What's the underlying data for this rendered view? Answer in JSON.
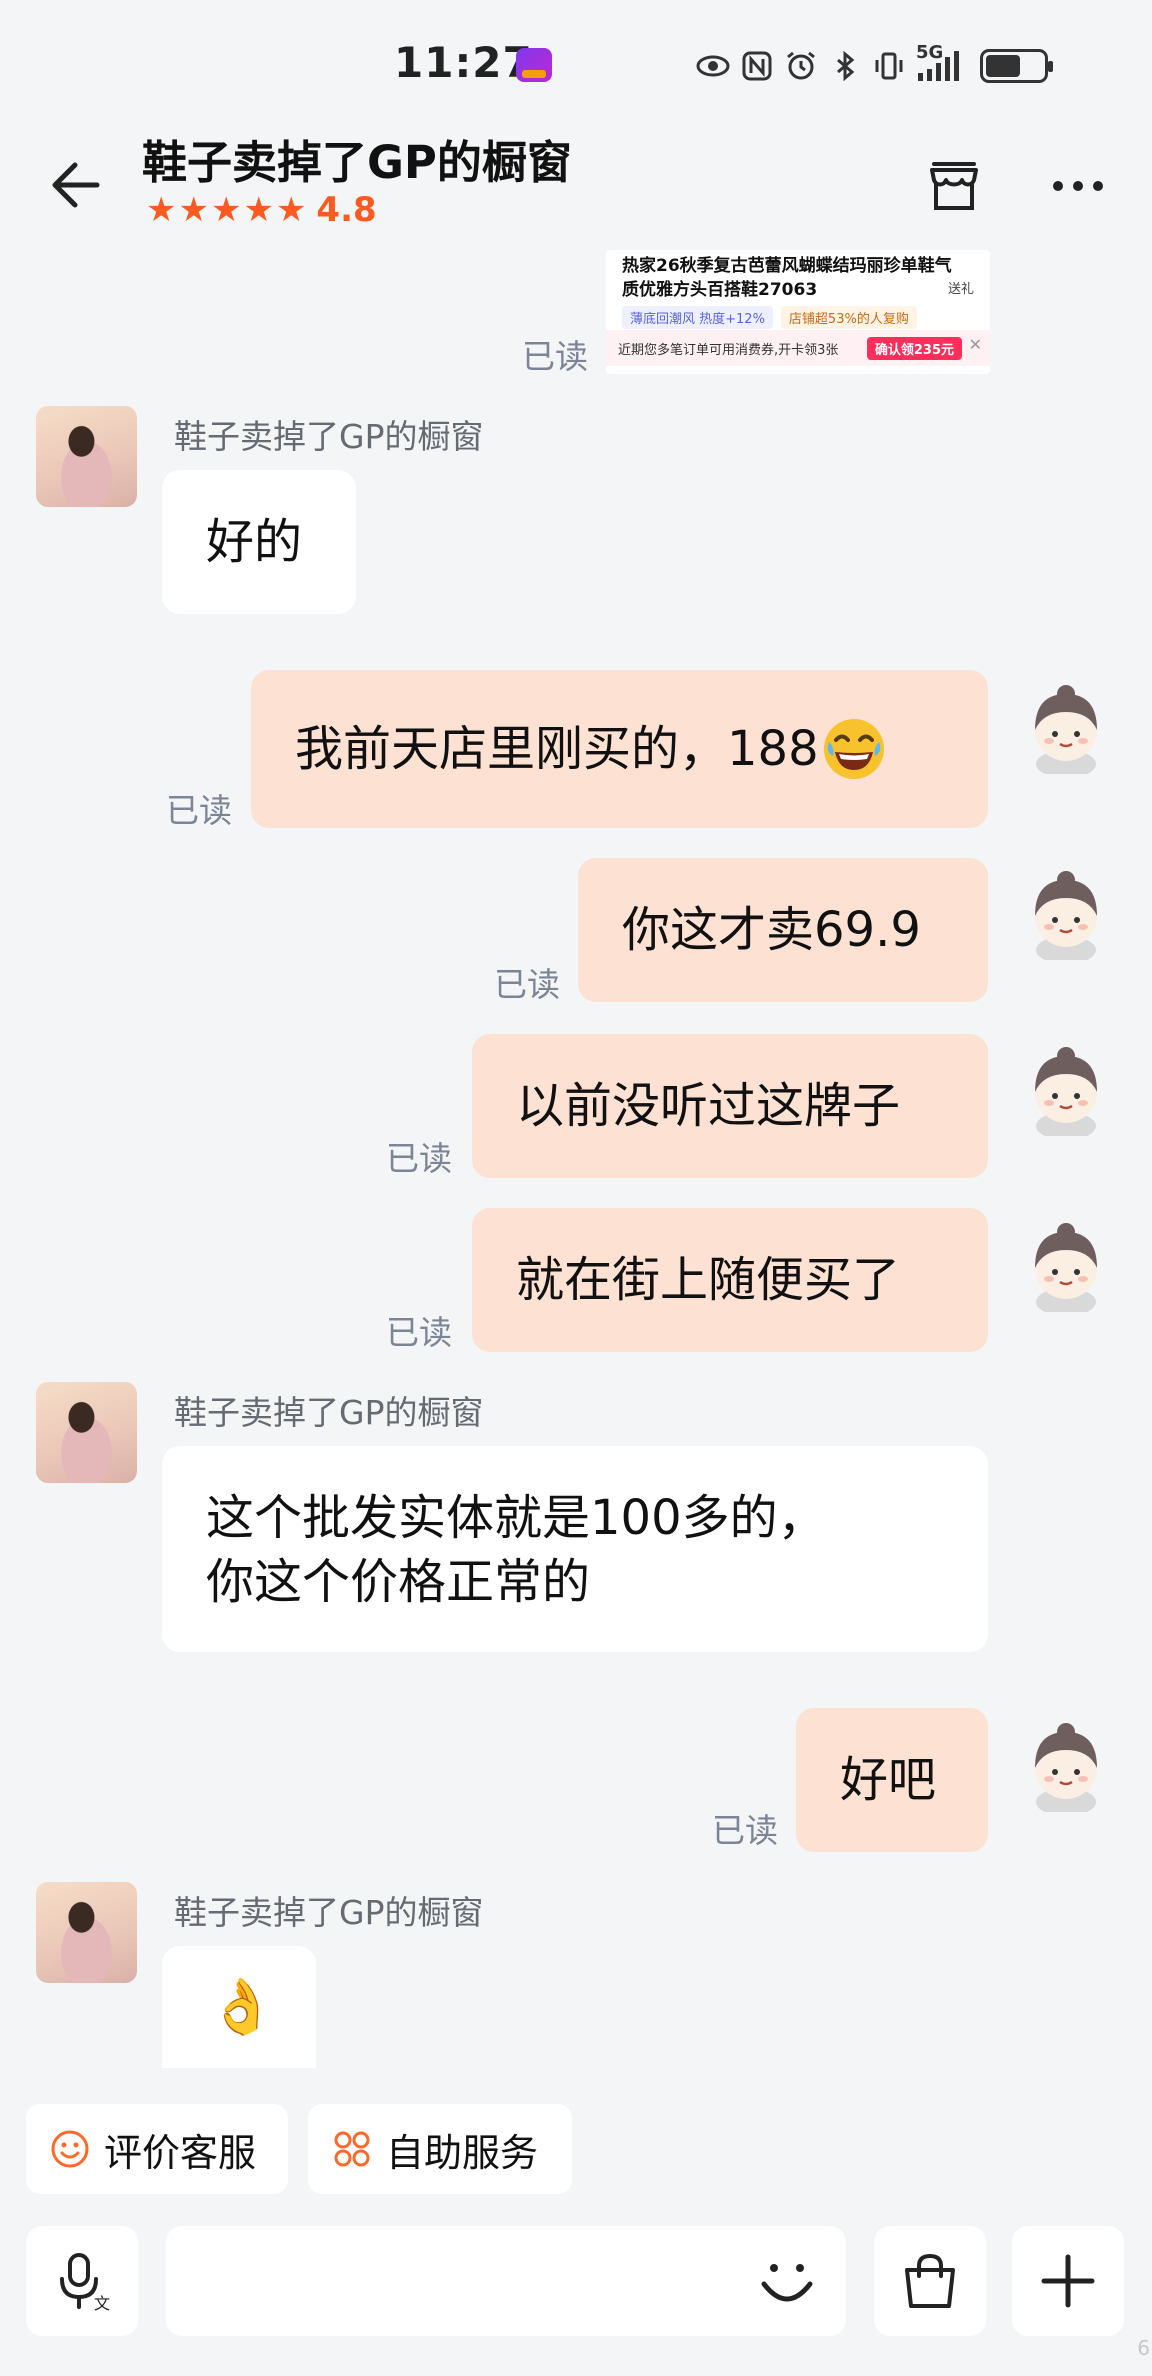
{
  "status_bar": {
    "time": "11:27",
    "network": "5G"
  },
  "header": {
    "title": "鞋子卖掉了GP的橱窗",
    "rating": "4.8",
    "stars": 5
  },
  "product_card": {
    "title": "热家26秋季复古芭蕾风蝴蝶结玛丽珍单鞋气质优雅方头百搭鞋27063",
    "gift": "送礼",
    "tag1": "薄底回潮风 热度+12%",
    "tag2": "店铺超53%的人复购",
    "coupon_text": "近期您多笔订单可用消费券,开卡领3张",
    "coupon_button": "确认领235元"
  },
  "read_label": "已读",
  "messages": [
    {
      "sender": "鞋子卖掉了GP的橱窗",
      "text": "好的"
    },
    {
      "text": "我前天店里刚买的，188"
    },
    {
      "text": "你这才卖69.9"
    },
    {
      "text": "以前没听过这牌子"
    },
    {
      "text": "就在街上随便买了"
    },
    {
      "sender": "鞋子卖掉了GP的橱窗",
      "line1": "这个批发实体就是100多的，",
      "line2": "你这个价格正常的"
    },
    {
      "text": "好吧"
    },
    {
      "sender": "鞋子卖掉了GP的橱窗",
      "text": "👌"
    }
  ],
  "actions": {
    "rate_service": "评价客服",
    "self_service": "自助服务"
  },
  "input": {
    "placeholder": ""
  },
  "corner_text": "6",
  "colors": {
    "accent": "#ff5a1f",
    "out_bubble": "#fde1d3",
    "in_bubble": "#ffffff",
    "background": "#f4f5f7"
  }
}
